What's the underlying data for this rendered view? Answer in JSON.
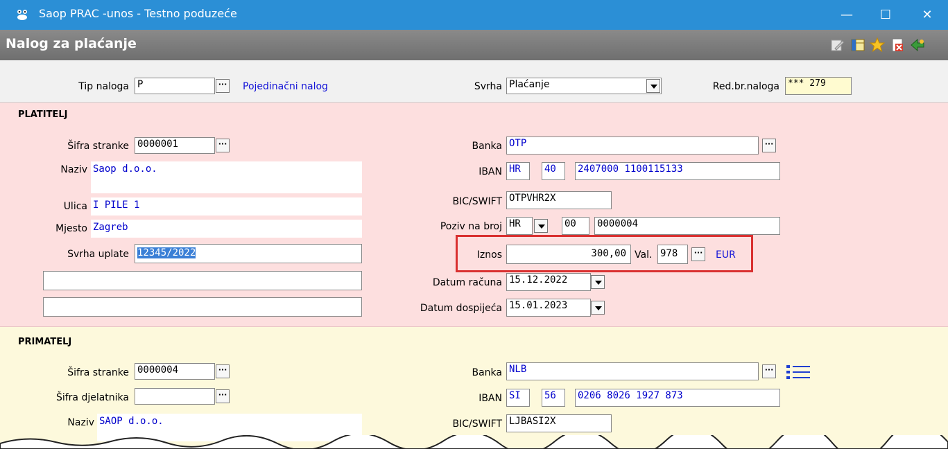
{
  "window": {
    "title": "Saop PRAC -unos - Testno poduzeće",
    "minimize": "—",
    "maximize": "☐",
    "close": "✕"
  },
  "form_header": {
    "title": "Nalog za plaćanje"
  },
  "top": {
    "tip_naloga_label": "Tip naloga",
    "tip_naloga_value": "P",
    "tip_naloga_desc": "Pojedinačni nalog",
    "svrha_label": "Svrha",
    "svrha_value": "Plaćanje",
    "redbr_label": "Red.br.naloga",
    "redbr_value": "*** 279"
  },
  "platitelj": {
    "section_title": "PLATITELJ",
    "sifra_label": "Šifra stranke",
    "sifra_value": "0000001",
    "naziv_label": "Naziv",
    "naziv_value": "Saop d.o.o.",
    "ulica_label": "Ulica",
    "ulica_value": "I PILE 1",
    "mjesto_label": "Mjesto",
    "mjesto_value": "Zagreb",
    "svrha_uplate_label": "Svrha uplate",
    "svrha_uplate_value": "12345/2022",
    "banka_label": "Banka",
    "banka_value": "OTP",
    "iban_label": "IBAN",
    "iban_country": "HR",
    "iban_check": "40",
    "iban_number": "2407000 1100115133",
    "bic_label": "BIC/SWIFT",
    "bic_value": "OTPVHR2X",
    "poziv_label": "Poziv na broj",
    "poziv_country": "HR",
    "poziv_model": "00",
    "poziv_number": "0000004",
    "iznos_label": "Iznos",
    "iznos_value": "300,00",
    "val_label": "Val.",
    "val_code": "978",
    "val_name": "EUR",
    "datum_racuna_label": "Datum računa",
    "datum_racuna_value": "15.12.2022",
    "datum_dosp_label": "Datum dospijeća",
    "datum_dosp_value": "15.01.2023"
  },
  "primatelj": {
    "section_title": "PRIMATELJ",
    "sifra_label": "Šifra stranke",
    "sifra_value": "0000004",
    "djelatnik_label": "Šifra djelatnika",
    "djelatnik_value": "",
    "naziv_label": "Naziv",
    "naziv_value": "SAOP d.o.o.",
    "banka_label": "Banka",
    "banka_value": "NLB",
    "iban_label": "IBAN",
    "iban_country": "SI",
    "iban_check": "56",
    "iban_number": "0206 8026 1927 873",
    "bic_label": "BIC/SWIFT",
    "bic_value": "LJBASI2X"
  },
  "colors": {
    "titlebar": "#2b8fd6",
    "highlight_border": "#d93030",
    "payer_bg": "#fddfdf",
    "payee_bg": "#fdf9dc"
  }
}
